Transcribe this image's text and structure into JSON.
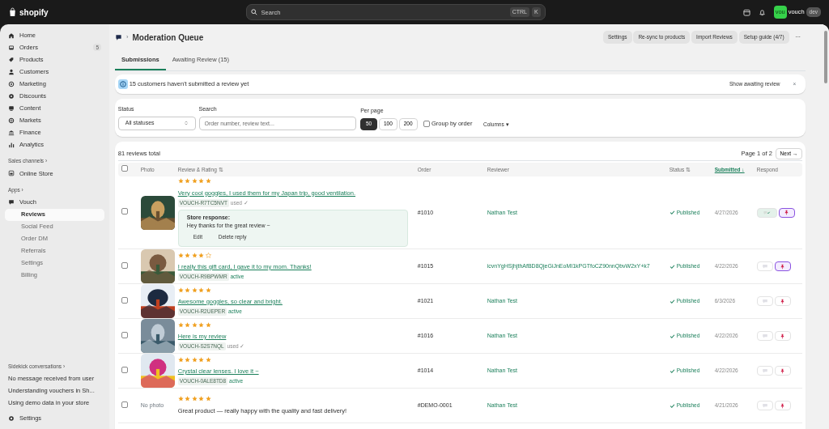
{
  "topbar": {
    "logo": "shopify",
    "search": {
      "placeholder": "Search",
      "keys": [
        "CTRL",
        "K"
      ]
    },
    "store": {
      "avatar": "vou",
      "name": "vouch",
      "badge": "dev"
    }
  },
  "sidebar": {
    "items": [
      {
        "label": "Home",
        "selected": false
      },
      {
        "label": "Orders",
        "selected": false,
        "badge": "5"
      },
      {
        "label": "Products",
        "selected": false
      },
      {
        "label": "Customers",
        "selected": false
      },
      {
        "label": "Marketing",
        "selected": false
      },
      {
        "label": "Discounts",
        "selected": false
      },
      {
        "label": "Content",
        "selected": false
      },
      {
        "label": "Markets",
        "selected": false
      },
      {
        "label": "Finance",
        "selected": false
      },
      {
        "label": "Analytics",
        "selected": false
      }
    ],
    "sales_channels": {
      "heading": "Sales channels ›",
      "items": [
        {
          "label": "Online Store",
          "selected": false
        }
      ]
    },
    "apps": {
      "heading": "Apps ›",
      "items": [
        {
          "label": "Vouch",
          "selected": false,
          "children": [
            {
              "label": "Reviews",
              "selected": true
            },
            {
              "label": "Social Feed",
              "selected": false
            },
            {
              "label": "Order DM",
              "selected": false
            },
            {
              "label": "Referrals",
              "selected": false
            },
            {
              "label": "Settings",
              "selected": false
            },
            {
              "label": "Billing",
              "selected": false
            }
          ]
        }
      ]
    },
    "sidekick": {
      "heading": "Sidekick conversations ›",
      "items": [
        "No message received from user",
        "Understanding vouchers in Sh...",
        "Using demo data in your store"
      ]
    },
    "footer": {
      "label": "Settings"
    }
  },
  "header": {
    "separator": "›",
    "title": "Moderation Queue",
    "buttons": [
      "Settings",
      "Re-sync to products",
      "Import Reviews",
      "Setup guide (4/7)"
    ],
    "more": "···"
  },
  "tabs": [
    {
      "label": "Submissions",
      "selected": true
    },
    {
      "label": "Awaiting Review (15)",
      "selected": false
    }
  ],
  "banner": {
    "text": "15 customers haven't submitted a review yet",
    "action": "Show awaiting review",
    "close": "×"
  },
  "filters": {
    "status": {
      "label": "Status",
      "value": "All statuses"
    },
    "search": {
      "label": "Search",
      "placeholder": "Order number, review text..."
    },
    "per_page": {
      "label": "Per page",
      "options": [
        {
          "label": "50",
          "selected": true
        },
        {
          "label": "100",
          "selected": false
        },
        {
          "label": "200",
          "selected": false
        }
      ]
    },
    "group_by_order": {
      "label": "Group by order",
      "checked": false
    },
    "columns": "Columns ▾"
  },
  "table": {
    "total": "81 reviews total",
    "page": "Page 1 of 2",
    "next": "Next →",
    "select_all": {
      "checked": false
    },
    "columns": [
      {
        "label": "Photo",
        "active": false
      },
      {
        "label": "Review & Rating",
        "sort": "⇅",
        "active": false
      },
      {
        "label": "Order",
        "active": false
      },
      {
        "label": "Reviewer",
        "active": false
      },
      {
        "label": "Status",
        "sort": "⇅",
        "active": false
      },
      {
        "label": "Submitted",
        "sort": "↓",
        "active": true
      },
      {
        "label": "Respond",
        "active": false
      }
    ],
    "rows": [
      {
        "checked": false,
        "stars": 5,
        "review": "Very cool goggles, I used them for my Japan trip, good ventilation.",
        "voucher": "VOUCH-R7TC5NVT",
        "voucher_state": "used ✓",
        "voucher_used": true,
        "response": {
          "label": "Store response:",
          "text": "Hey thanks for the great review ~",
          "actions": [
            "Edit",
            "Delete reply"
          ]
        },
        "order": "#1010",
        "reviewer": "Nathan Test",
        "status": "Published",
        "submitted": "4/27/2026",
        "responded": true,
        "pinned": true
      },
      {
        "checked": false,
        "stars": 4,
        "review": "I really this gift card, I gave it to my mom. Thanks!",
        "voucher": "VOUCH-R9BPWMR",
        "voucher_state": "active",
        "voucher_used": false,
        "order": "#1015",
        "reviewer": "icvnYgHSjhjthAfBD8QjeGiJnEoMI1kPGTfoCZ90nnQbvW2xY+k7",
        "status": "Published",
        "submitted": "4/22/2026",
        "responded": false,
        "pinned": true
      },
      {
        "checked": false,
        "stars": 5,
        "review": "Awesome goggles, so clear and bright.",
        "voucher": "VOUCH-R2UEPER",
        "voucher_state": "active",
        "voucher_used": false,
        "order": "#1021",
        "reviewer": "Nathan Test",
        "status": "Published",
        "submitted": "6/3/2026",
        "responded": false,
        "pinned": false
      },
      {
        "checked": false,
        "stars": 5,
        "review": "Here is my review",
        "voucher": "VOUCH-S2S7NQL",
        "voucher_state": "used ✓",
        "voucher_used": true,
        "order": "#1016",
        "reviewer": "Nathan Test",
        "status": "Published",
        "submitted": "4/22/2026",
        "responded": false,
        "pinned": false
      },
      {
        "checked": false,
        "stars": 5,
        "review": "Crystal clear lenses. I love it ~",
        "voucher": "VOUCH-0ALE8TD8",
        "voucher_state": "active",
        "voucher_used": false,
        "order": "#1014",
        "reviewer": "Nathan Test",
        "status": "Published",
        "submitted": "4/22/2026",
        "responded": false,
        "pinned": false
      },
      {
        "checked": false,
        "photo": {
          "kind": "none",
          "text": "No photo"
        },
        "stars": 5,
        "review": "Great product — really happy with the quality and fast delivery!",
        "order": "#DEMO-0001",
        "reviewer": "Nathan Test",
        "status": "Published",
        "submitted": "4/21/2026",
        "responded": false,
        "pinned": false
      }
    ]
  }
}
